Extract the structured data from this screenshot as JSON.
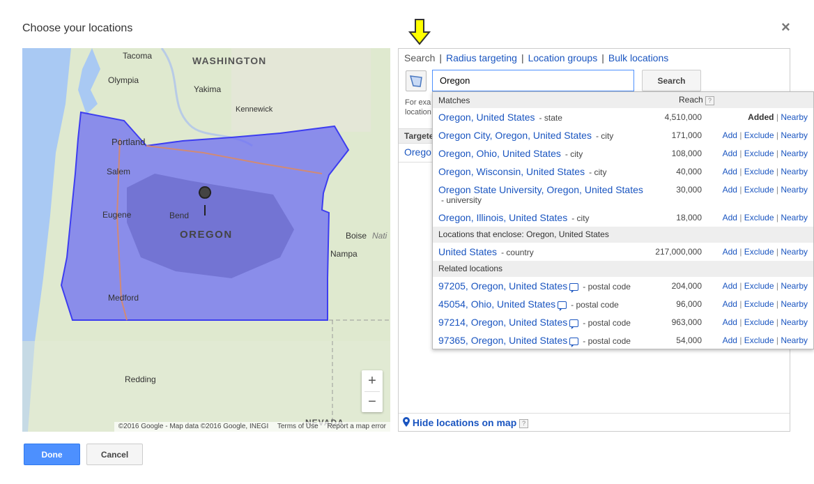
{
  "dialog": {
    "title": "Choose your locations",
    "close_glyph": "×"
  },
  "map": {
    "cities": [
      "Tacoma",
      "WASHINGTON",
      "Olympia",
      "Yakima",
      "Kennewick",
      "Portland",
      "Salem",
      "Eugene",
      "Bend",
      "OREGON",
      "Boise",
      "Nati",
      "Nampa",
      "Medford",
      "Redding",
      "NEVADA"
    ],
    "zoom_in": "+",
    "zoom_out": "−",
    "attribution": {
      "copyright": "©2016 Google - Map data ©2016 Google, INEGI",
      "terms": "Terms of Use",
      "report": "Report a map error"
    },
    "colors": {
      "water": "#a9c9f3",
      "land": "#dfe9cf",
      "region_fill": "#6d6df3",
      "region_stroke": "#3d3df0"
    }
  },
  "panel": {
    "tabs": [
      "Search",
      "Radius targeting",
      "Location groups",
      "Bulk locations"
    ],
    "tab_separator": "|",
    "search": {
      "value": "Oregon",
      "button": "Search"
    },
    "hint_lines": [
      "For exa",
      "location"
    ],
    "targeted_header": "Targete",
    "targeted_item": "Orego",
    "hide_map": "Hide locations on map",
    "help_glyph": "?"
  },
  "dropdown": {
    "header": {
      "label": "Matches",
      "reach": "Reach"
    },
    "matches": [
      {
        "name": "Oregon, United States",
        "type": "- state",
        "reach": "4,510,000",
        "status": "Added"
      },
      {
        "name": "Oregon City, Oregon, United States",
        "type": "- city",
        "reach": "171,000"
      },
      {
        "name": "Oregon, Ohio, United States",
        "type": "- city",
        "reach": "108,000"
      },
      {
        "name": "Oregon, Wisconsin, United States",
        "type": "- city",
        "reach": "40,000"
      },
      {
        "name": "Oregon State University, Oregon, United States",
        "type": "- university",
        "reach": "30,000"
      },
      {
        "name": "Oregon, Illinois, United States",
        "type": "- city",
        "reach": "18,000"
      }
    ],
    "enclose_section": "Locations that enclose: Oregon, United States",
    "enclose": [
      {
        "name": "United States",
        "type": "- country",
        "reach": "217,000,000"
      }
    ],
    "related_section": "Related locations",
    "related": [
      {
        "name": "97205, Oregon, United States",
        "type": "- postal code",
        "reach": "204,000"
      },
      {
        "name": "45054, Ohio, United States",
        "type": "- postal code",
        "reach": "96,000"
      },
      {
        "name": "97214, Oregon, United States",
        "type": "- postal code",
        "reach": "963,000"
      },
      {
        "name": "97365, Oregon, United States",
        "type": "- postal code",
        "reach": "54,000"
      }
    ],
    "actions": {
      "add": "Add",
      "exclude": "Exclude",
      "nearby": "Nearby",
      "sep": "|"
    }
  },
  "footer": {
    "done": "Done",
    "cancel": "Cancel"
  },
  "accent": "#4d90fe",
  "link_color": "#1a55c0"
}
